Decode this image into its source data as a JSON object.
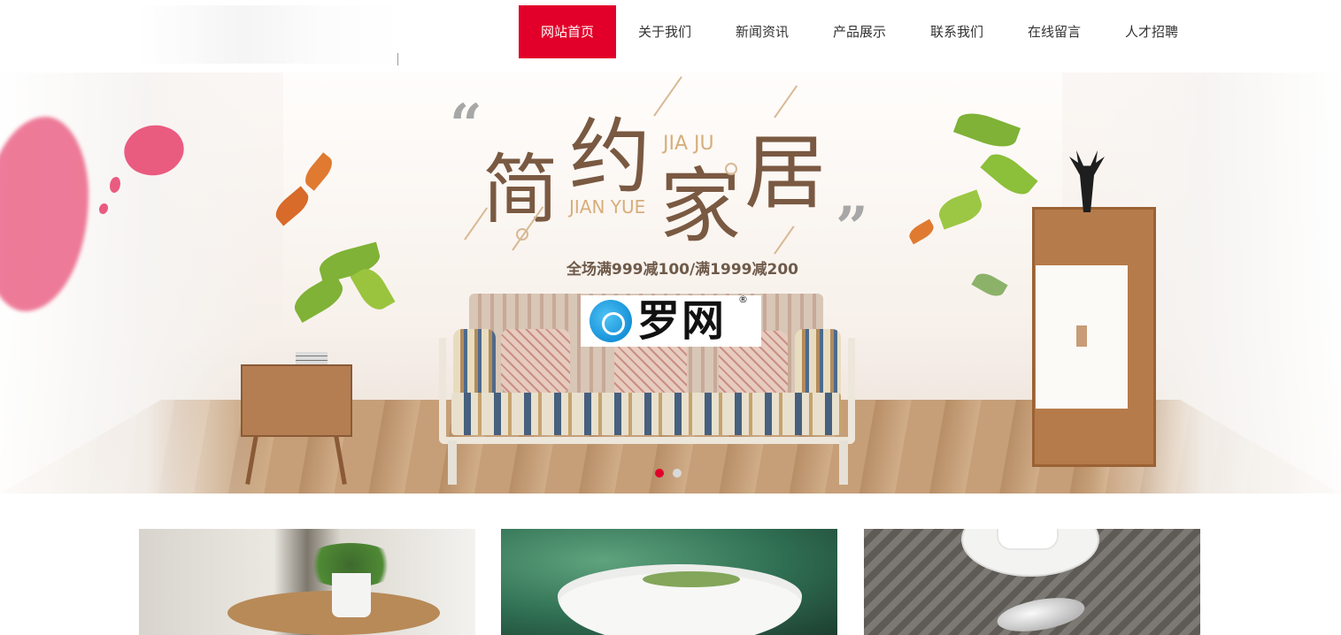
{
  "header": {
    "nav": [
      {
        "label": "网站首页",
        "active": true
      },
      {
        "label": "关于我们",
        "active": false
      },
      {
        "label": "新闻资讯",
        "active": false
      },
      {
        "label": "产品展示",
        "active": false
      },
      {
        "label": "联系我们",
        "active": false
      },
      {
        "label": "在线留言",
        "active": false
      },
      {
        "label": "人才招聘",
        "active": false
      }
    ]
  },
  "banner": {
    "title_chars": [
      "简",
      "约",
      "家",
      "居"
    ],
    "pinyin_top": "JIA JU",
    "pinyin_bottom": "JIAN YUE",
    "quote_open": "“",
    "quote_close": "”",
    "promo": "全场满999减100/满1999减200",
    "watermark_text": "罗网",
    "watermark_reg": "®",
    "slides_total": 2,
    "slide_active": 1
  },
  "colors": {
    "accent": "#e2002a",
    "title_brown": "#7a5942"
  }
}
